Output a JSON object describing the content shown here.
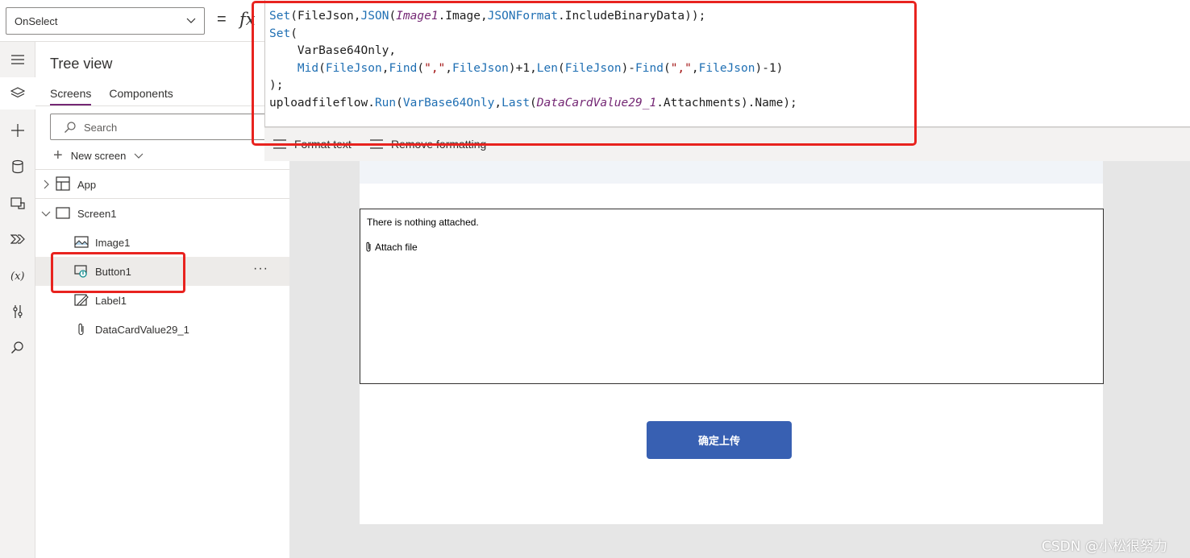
{
  "formula_bar": {
    "property": "OnSelect",
    "equals": "=",
    "fx": "fx"
  },
  "tree_view": {
    "title": "Tree view",
    "tabs": [
      "Screens",
      "Components"
    ],
    "search_placeholder": "Search",
    "new_screen": "New screen",
    "nodes": [
      {
        "label": "App",
        "icon": "app-icon"
      },
      {
        "label": "Screen1",
        "icon": "screen-icon"
      },
      {
        "label": "Image1",
        "icon": "image-icon"
      },
      {
        "label": "Button1",
        "icon": "button-icon",
        "selected": true
      },
      {
        "label": "Label1",
        "icon": "label-icon"
      },
      {
        "label": "DataCardValue29_1",
        "icon": "attachment-icon"
      }
    ],
    "more_menu": "···"
  },
  "editor": {
    "lines": [
      "Set(FileJson,JSON(Image1.Image,JSONFormat.IncludeBinaryData));",
      "Set(",
      "    VarBase64Only,",
      "    Mid(FileJson,Find(\",\",FileJson)+1,Len(FileJson)-Find(\",\",FileJson)-1)",
      ");",
      "uploadfileflow.Run(VarBase64Only,Last(DataCardValue29_1.Attachments).Name);"
    ],
    "toolbar": {
      "format_text": "Format text",
      "remove_formatting": "Remove formatting"
    }
  },
  "canvas": {
    "attachments_message": "There is nothing attached.",
    "attach_file": "Attach file",
    "upload_button": "确定上传"
  },
  "watermark": "CSDN @小松很努力",
  "colors": {
    "accent": "#742774",
    "button": "#3860b2",
    "highlight": "#e8231f"
  }
}
